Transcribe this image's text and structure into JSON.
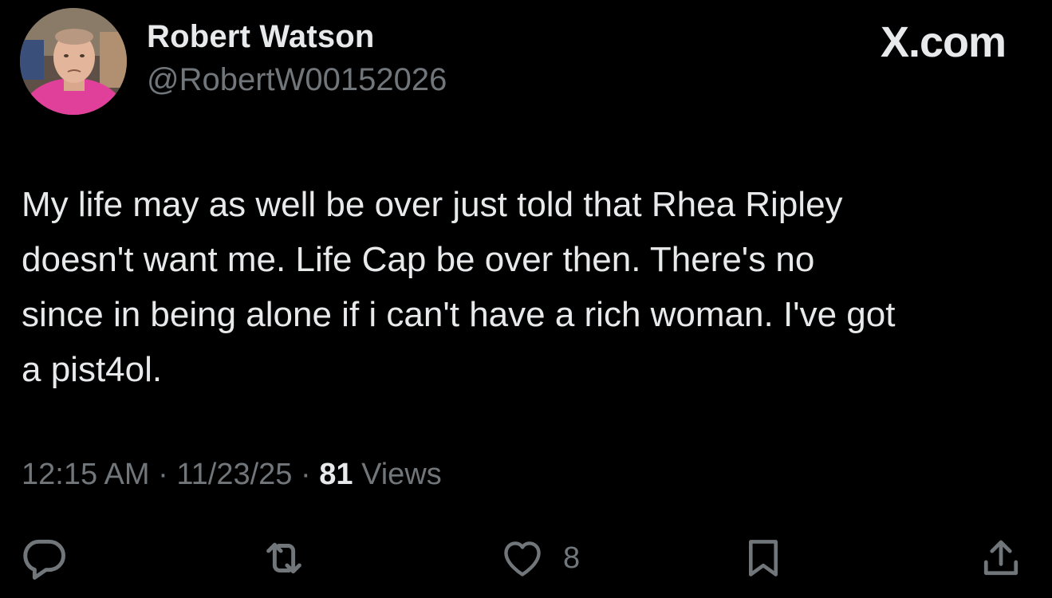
{
  "user": {
    "display_name": "Robert Watson",
    "handle": "@RobertW00152026"
  },
  "brand": "X.com",
  "tweet": {
    "lines": [
      "My life may as well be over just told that Rhea Ripley",
      "doesn't want me. Life Cap be over then. There's no",
      "since in being alone if i can't have a rich woman. I've got",
      "a pist4ol."
    ]
  },
  "meta": {
    "time": "12:15 AM",
    "separator": "·",
    "date": "11/23/25",
    "views_count": "81",
    "views_label": "Views"
  },
  "actions": {
    "reply_icon": "reply-icon",
    "retweet_icon": "retweet-icon",
    "like_icon": "heart-icon",
    "like_count": "8",
    "bookmark_icon": "bookmark-icon",
    "share_icon": "share-icon"
  },
  "colors": {
    "background": "#000000",
    "primary_text": "#e7e9ea",
    "secondary_text": "#71767b"
  }
}
